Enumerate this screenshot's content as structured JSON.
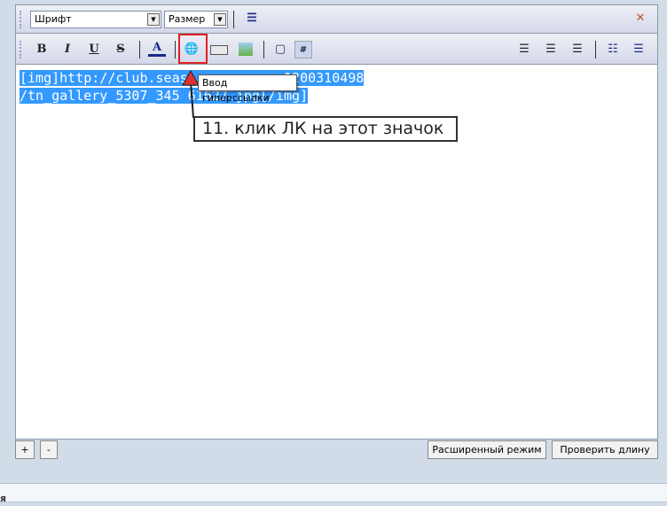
{
  "toolbar": {
    "font_select": "Шрифт",
    "size_select": "Размер"
  },
  "editor": {
    "line1": "[img]http://club.seas",
    "line1_end": "1200310498",
    "line2": "/tn_gallery_5307_345",
    "line2_end": "61627.jpg[/img]"
  },
  "tooltip": "Ввод гиперссылки",
  "annotation": "11. клик ЛК на этот значок",
  "buttons": {
    "plus": "+",
    "minus": "-",
    "advanced": "Расширенный режим",
    "check_length": "Проверить длину"
  },
  "footer_text": "я",
  "colors": {
    "accent": "#3399ff",
    "highlight": "#e02020"
  }
}
